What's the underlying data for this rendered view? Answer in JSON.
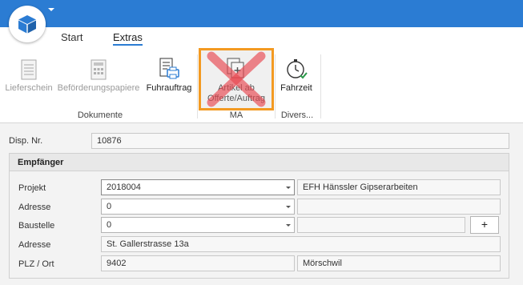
{
  "ribbon": {
    "tabs": [
      {
        "label": "Start"
      },
      {
        "label": "Extras"
      }
    ],
    "groups": {
      "dokumente": {
        "label": "Dokumente",
        "buttons": [
          {
            "label": "Lieferschein",
            "enabled": false,
            "icon": "document-icon"
          },
          {
            "label": "Beförderungspapiere",
            "enabled": false,
            "icon": "calculator-document-icon"
          },
          {
            "label": "Fuhrauftrag",
            "enabled": true,
            "icon": "print-document-icon"
          }
        ]
      },
      "ma": {
        "label": "MA",
        "buttons": [
          {
            "label_line1": "Artikel ab",
            "label_line2": "Offerte/Auftrag",
            "enabled": true,
            "icon": "copy-add-icon"
          }
        ]
      },
      "divers": {
        "label": "Divers...",
        "buttons": [
          {
            "label": "Fahrzeit",
            "enabled": true,
            "icon": "stopwatch-icon"
          }
        ]
      }
    }
  },
  "form": {
    "disp_nr": {
      "label": "Disp. Nr.",
      "value": "10876"
    },
    "empfaenger": {
      "title": "Empfänger",
      "projekt": {
        "label": "Projekt",
        "value": "2018004",
        "description": "EFH Hänssler Gipserarbeiten"
      },
      "adresse_select": {
        "label": "Adresse",
        "value": "0",
        "description": ""
      },
      "baustelle": {
        "label": "Baustelle",
        "value": "0",
        "description": "",
        "add_label": "+"
      },
      "adresse": {
        "label": "Adresse",
        "value": "St. Gallerstrasse 13a"
      },
      "plz_ort": {
        "label": "PLZ / Ort",
        "plz": "9402",
        "ort": "Mörschwil"
      }
    }
  },
  "colors": {
    "titlebar": "#2b7cd3",
    "highlight": "#f39a22",
    "cross": "#e8454e"
  }
}
